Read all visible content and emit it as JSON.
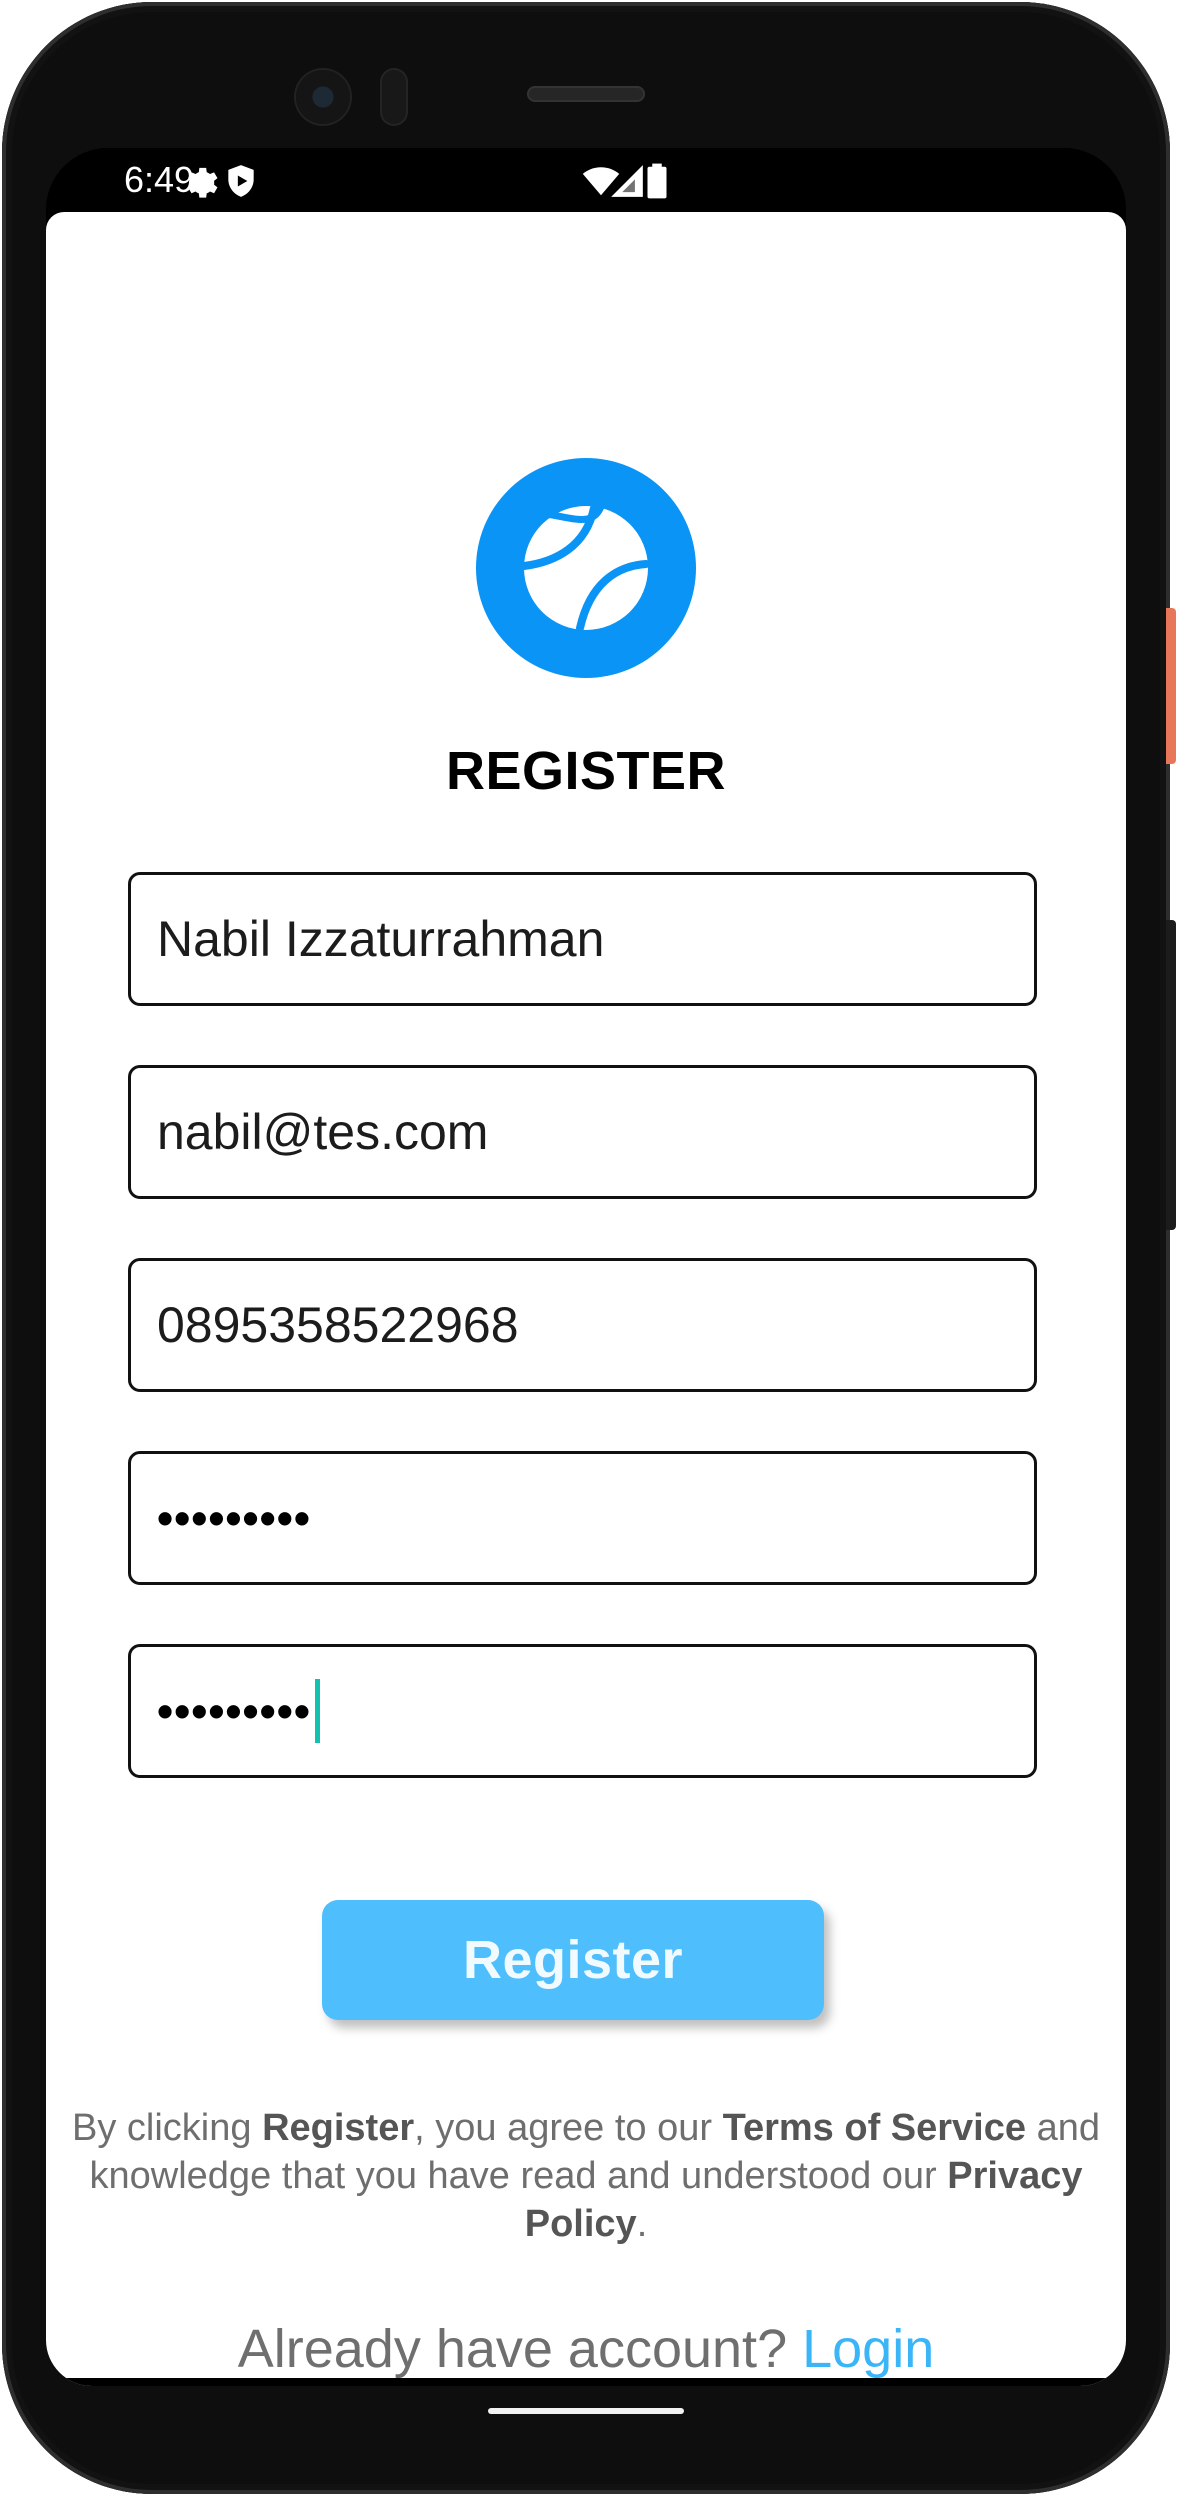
{
  "status_bar": {
    "time": "6:49",
    "left_icons": [
      "gear-icon",
      "shield-icon"
    ],
    "right_icons": [
      "wifi-icon",
      "signal-icon",
      "battery-icon"
    ]
  },
  "app": {
    "logo_icon": "tennis-ball-icon",
    "brand_color": "#0a94f5",
    "title": "REGISTER",
    "fields": [
      {
        "name": "name-field",
        "value": "Nabil Izzaturrahman"
      },
      {
        "name": "email-field",
        "value": "nabil@tes.com"
      },
      {
        "name": "phone-field",
        "value": "0895358522968"
      },
      {
        "name": "password-field",
        "value": "•••••••••"
      },
      {
        "name": "confirm-password-field",
        "value": "•••••••••"
      }
    ],
    "register_button": {
      "label": "Register",
      "color": "#4ebffc"
    },
    "terms": {
      "prefix": "By clicking ",
      "register_word": "Register",
      "middle": ", you agree to our ",
      "terms_link": "Terms of Service",
      "suffix": " and knowledge that you have read and understood our ",
      "privacy_link": "Privacy Policy",
      "end": "."
    },
    "footer": {
      "question": "Already have account? ",
      "login_label": "Login",
      "login_color": "#3ab5f7"
    }
  }
}
